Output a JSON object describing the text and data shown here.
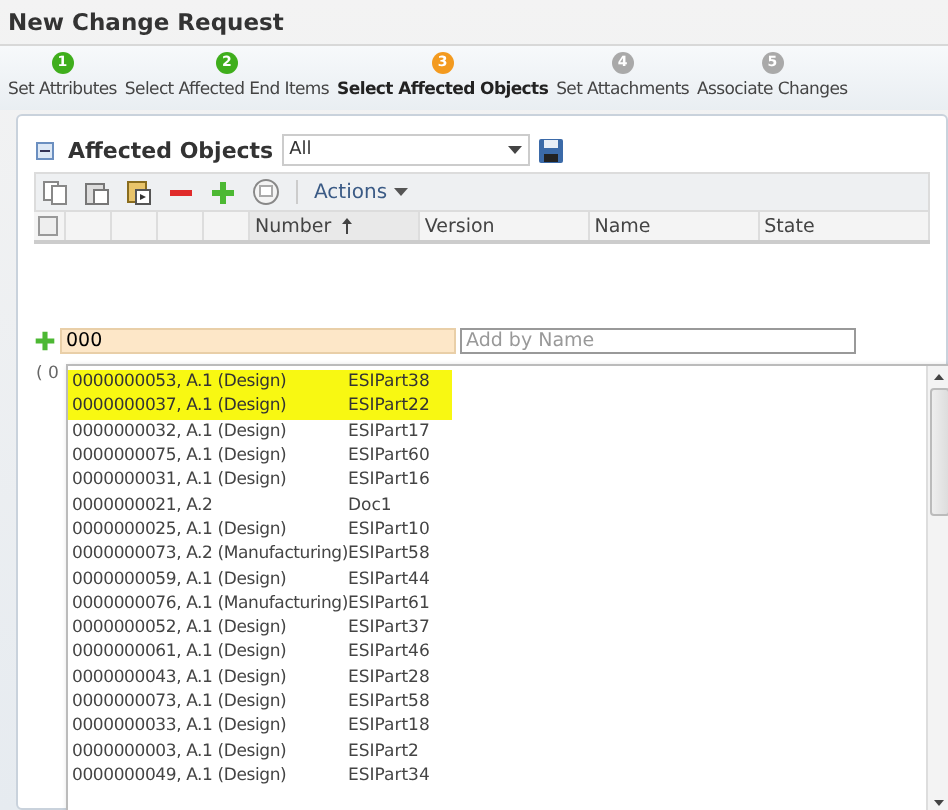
{
  "window": {
    "title": "New Change Request"
  },
  "steps": [
    {
      "number": "1",
      "label": "Set Attributes",
      "kind": "complete",
      "selected": false
    },
    {
      "number": "2",
      "label": "Select Affected End Items",
      "kind": "complete",
      "selected": false
    },
    {
      "number": "3",
      "label": "Select Affected Objects",
      "kind": "current",
      "selected": true
    },
    {
      "number": "4",
      "label": "Set Attachments",
      "kind": "pending",
      "selected": false
    },
    {
      "number": "5",
      "label": "Associate Changes",
      "kind": "pending",
      "selected": false
    }
  ],
  "panel": {
    "title": "Affected Objects",
    "view_filter": "All",
    "actions_menu": "Actions",
    "select_all_checked": false,
    "columns": [
      "Number",
      "Version",
      "Name",
      "State"
    ],
    "add_number_field": {
      "value": "000"
    },
    "add_name_field": {
      "placeholder": "Add by Name"
    },
    "count_text": "( 0",
    "suggestions": [
      {
        "text": "0000000053, A.1 (Design)",
        "name": "ESIPart38",
        "selected": true
      },
      {
        "text": "0000000037, A.1 (Design)",
        "name": "ESIPart22",
        "selected": true
      },
      {
        "text": "0000000032, A.1 (Design)",
        "name": "ESIPart17",
        "selected": false
      },
      {
        "text": "0000000075, A.1 (Design)",
        "name": "ESIPart60",
        "selected": false
      },
      {
        "text": "0000000031, A.1 (Design)",
        "name": "ESIPart16",
        "selected": false
      },
      {
        "text": "0000000021, A.2",
        "name": "Doc1",
        "selected": false
      },
      {
        "text": "0000000025, A.1 (Design)",
        "name": "ESIPart10",
        "selected": false
      },
      {
        "text": "0000000073, A.2 (Manufacturing)",
        "name": "ESIPart58",
        "selected": false
      },
      {
        "text": "0000000059, A.1 (Design)",
        "name": "ESIPart44",
        "selected": false
      },
      {
        "text": "0000000076, A.1 (Manufacturing)",
        "name": "ESIPart61",
        "selected": false
      },
      {
        "text": "0000000052, A.1 (Design)",
        "name": "ESIPart37",
        "selected": false
      },
      {
        "text": "0000000061, A.1 (Design)",
        "name": "ESIPart46",
        "selected": false
      },
      {
        "text": "0000000043, A.1 (Design)",
        "name": "ESIPart28",
        "selected": false
      },
      {
        "text": "0000000073, A.1 (Design)",
        "name": "ESIPart58",
        "selected": false
      },
      {
        "text": "0000000033, A.1 (Design)",
        "name": "ESIPart18",
        "selected": false
      },
      {
        "text": "0000000003, A.1 (Design)",
        "name": "ESIPart2",
        "selected": false
      },
      {
        "text": "0000000049, A.1 (Design)",
        "name": "ESIPart34",
        "selected": false
      }
    ]
  }
}
